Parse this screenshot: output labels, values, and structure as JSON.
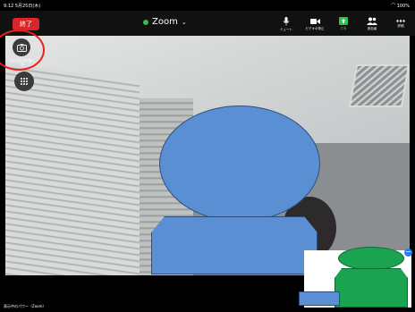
{
  "statusbar": {
    "time": "9:12  5月25日(木)",
    "battery": "100%"
  },
  "topbar": {
    "end_label": "終了",
    "title": "Zoom",
    "tools": [
      {
        "label": "ミュート",
        "icon": "microphone-icon"
      },
      {
        "label": "ビデオの停止",
        "icon": "video-camera-icon"
      },
      {
        "label": "共有",
        "icon": "share-screen-icon"
      },
      {
        "label": "参加者",
        "icon": "participants-icon"
      },
      {
        "label": "詳細",
        "icon": "more-icon"
      }
    ]
  },
  "sidebar": {
    "camera_switch_label": "カメラを切り替える"
  },
  "bottom": {
    "status_text": "表示中のパワー（Zoom）"
  },
  "colors": {
    "end_button": "#d9262b",
    "share_active": "#2fc14a",
    "annotation_ring": "#e8201c",
    "main_avatar": "#5b8fd4",
    "self_avatar": "#1aa351"
  }
}
